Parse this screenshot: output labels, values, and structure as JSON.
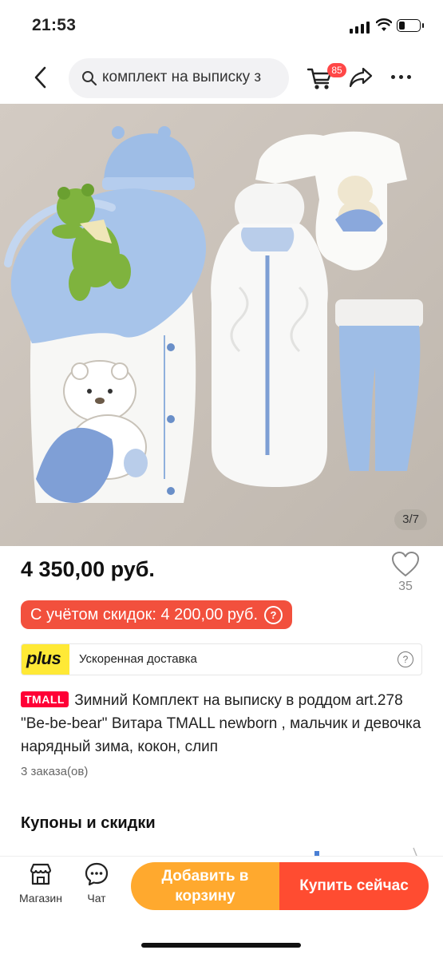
{
  "status_bar": {
    "time": "21:53",
    "battery_level": 0.3
  },
  "nav": {
    "search_text": "комплект на выписку з",
    "cart_badge": "85",
    "icons": [
      "chevron-left-icon",
      "search-icon",
      "cart-icon",
      "share-icon",
      "more-icon"
    ]
  },
  "gallery": {
    "page_indicator": "3/7"
  },
  "product": {
    "price": "4 350,00 руб.",
    "favorites_count": "35",
    "discount_label": "С учётом скидок: 4 200,00 руб.",
    "discount_help": "?",
    "plus": {
      "logo": "plus",
      "text": "Ускоренная доставка",
      "help": "?"
    },
    "tmall_badge": "TMALL",
    "title": "Зимний Комплект на выписку в роддом art.278 \"Be-be-bear\" Витара TMALL newborn , мальчик и девочка нарядный зима, кокон, слип",
    "orders": "3 заказа(ов)"
  },
  "coupons": {
    "title": "Купоны и скидки"
  },
  "bottom_bar": {
    "store_label": "Магазин",
    "chat_label": "Чат",
    "add_to_cart": "Добавить в корзину",
    "buy_now": "Купить сейчас"
  },
  "colors": {
    "accent_red": "#ff4c31",
    "accent_orange": "#ffa92e",
    "discount_pill": "#f2503d",
    "plus_yellow": "#ffe936",
    "tmall_red": "#ff0036"
  }
}
